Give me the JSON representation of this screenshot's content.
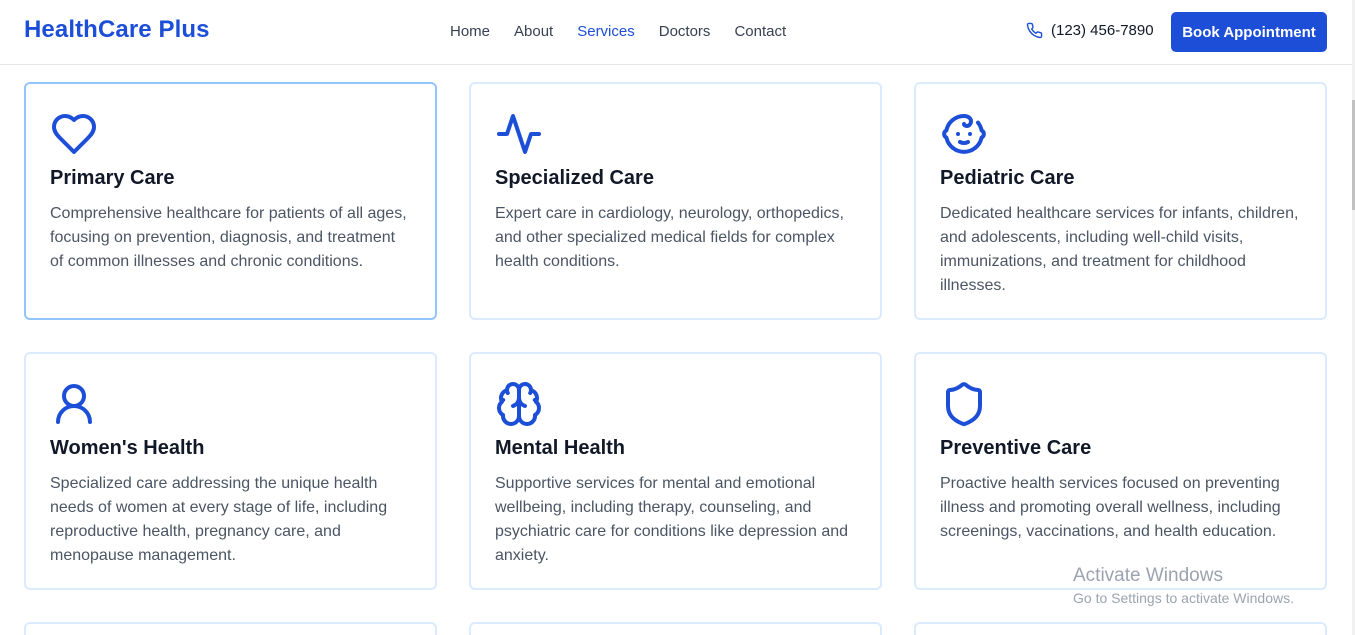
{
  "header": {
    "logo": "HealthCare Plus",
    "nav": [
      "Home",
      "About",
      "Services",
      "Doctors",
      "Contact"
    ],
    "active_nav": "Services",
    "phone": "(123) 456-7890",
    "book_label": "Book Appointment"
  },
  "colors": {
    "brand": "#1d4ed8",
    "card_border": "#dbeafe",
    "card_border_highlight": "#93c5fd"
  },
  "services": [
    {
      "icon": "heart-icon",
      "title": "Primary Care",
      "description": "Comprehensive healthcare for patients of all ages, focusing on prevention, diagnosis, and treatment of common illnesses and chronic conditions."
    },
    {
      "icon": "activity-icon",
      "title": "Specialized Care",
      "description": "Expert care in cardiology, neurology, orthopedics, and other specialized medical fields for complex health conditions."
    },
    {
      "icon": "baby-icon",
      "title": "Pediatric Care",
      "description": "Dedicated healthcare services for infants, children, and adolescents, including well-child visits, immunizations, and treatment for childhood illnesses."
    },
    {
      "icon": "user-icon",
      "title": "Women's Health",
      "description": "Specialized care addressing the unique health needs of women at every stage of life, including reproductive health, pregnancy care, and menopause management."
    },
    {
      "icon": "brain-icon",
      "title": "Mental Health",
      "description": "Supportive services for mental and emotional wellbeing, including therapy, counseling, and psychiatric care for conditions like depression and anxiety."
    },
    {
      "icon": "shield-icon",
      "title": "Preventive Care",
      "description": "Proactive health services focused on preventing illness and promoting overall wellness, including screenings, vaccinations, and health education."
    }
  ],
  "watermark": {
    "title": "Activate Windows",
    "subtitle": "Go to Settings to activate Windows."
  }
}
